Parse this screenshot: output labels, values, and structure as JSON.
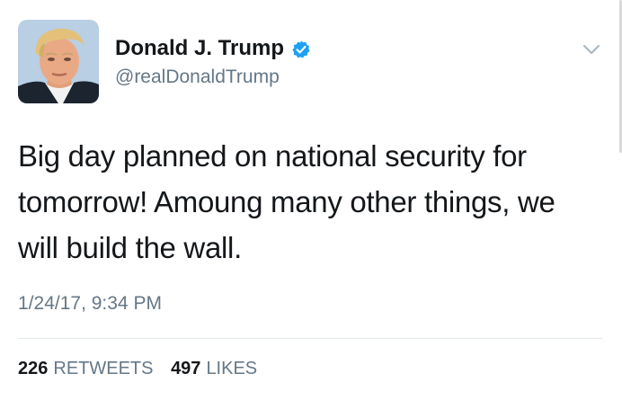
{
  "user": {
    "display_name": "Donald J. Trump",
    "handle": "@realDonaldTrump",
    "verified_icon": "verified-badge-icon",
    "verified_color": "#1da1f2"
  },
  "tweet": {
    "text": "Big day planned on national security for tomorrow! Amoung many other things, we will build the wall.",
    "timestamp": "1/24/17, 9:34 PM"
  },
  "stats": {
    "retweets_count": "226",
    "retweets_label": "RETWEETS",
    "likes_count": "497",
    "likes_label": "LIKES"
  },
  "menu": {
    "icon": "chevron-down-icon"
  },
  "colors": {
    "text_primary": "#14171a",
    "text_secondary": "#657786",
    "divider": "#e1e8ed",
    "accent": "#1da1f2"
  }
}
